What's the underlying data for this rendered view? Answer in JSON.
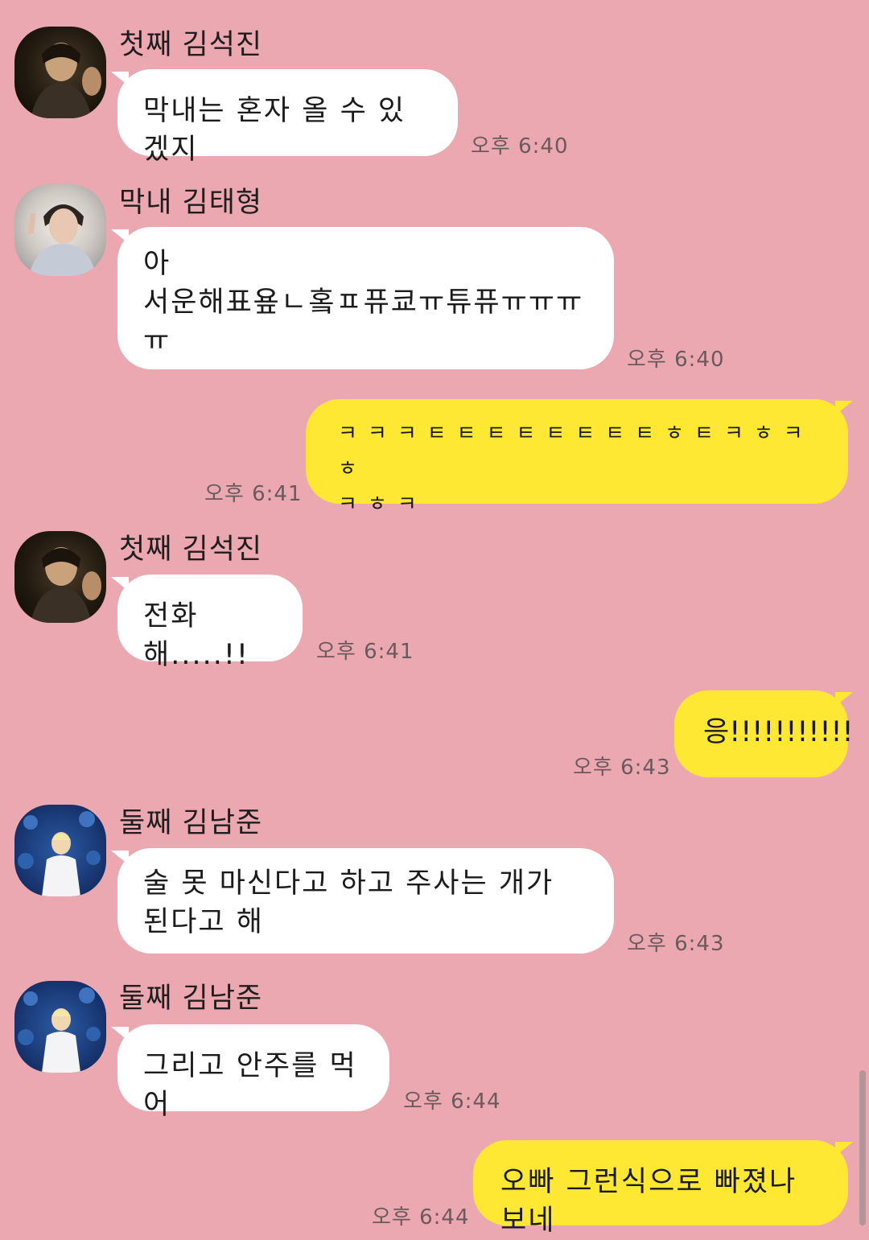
{
  "messages": [
    {
      "sender": "첫째 김석진",
      "text": "막내는 혼자 올 수 있겠지",
      "time": "오후 6:40"
    },
    {
      "sender": "막내 김태형",
      "text": "아\n서운해표욮ㄴ홐ㅍ퓨쿄ㅠ튜퓨ㅠㅠㅠ\nㅠ",
      "time": "오후 6:40"
    },
    {
      "sender": "me",
      "text": "ㅋㅋㅋㅌㅌㅌㅌㅌㅌㅌㅌㅎㅌㅋㅎㅋㅎ\nㅋㅎㅋ",
      "time": "오후 6:41"
    },
    {
      "sender": "첫째 김석진",
      "text": "전화해.....!!",
      "time": "오후 6:41"
    },
    {
      "sender": "me",
      "text": "응!!!!!!!!!!!",
      "time": "오후 6:43"
    },
    {
      "sender": "둘째 김남준",
      "text": "술 못 마신다고 하고 주사는 개가\n된다고 해",
      "time": "오후 6:43"
    },
    {
      "sender": "둘째 김남준",
      "text": "그리고 안주를 먹어",
      "time": "오후 6:44"
    },
    {
      "sender": "me",
      "text": "오빠 그런식으로 빠졌나보네",
      "time": "오후 6:44"
    }
  ],
  "colors": {
    "background": "#eba8b0",
    "incoming_bubble": "#ffffff",
    "outgoing_bubble": "#fee834"
  },
  "avatars": [
    "jin-avatar",
    "taehyung-avatar",
    "namjoon-avatar"
  ]
}
